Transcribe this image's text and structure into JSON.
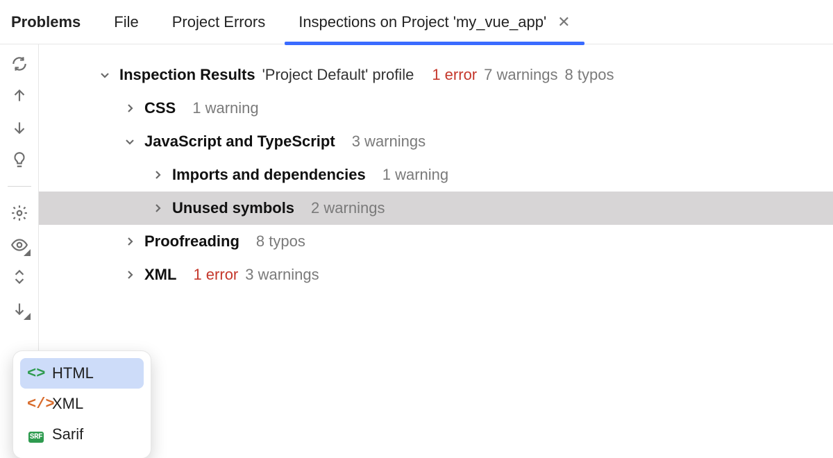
{
  "tabs": {
    "problems": "Problems",
    "file": "File",
    "project_errors": "Project Errors",
    "inspections": "Inspections on Project 'my_vue_app'"
  },
  "summary": {
    "title": "Inspection Results",
    "profile": "'Project Default' profile",
    "errors": "1 error",
    "warnings": "7 warnings",
    "typos": "8 typos"
  },
  "nodes": {
    "css": {
      "label": "CSS",
      "count": "1 warning"
    },
    "jsts": {
      "label": "JavaScript and TypeScript",
      "count": "3 warnings"
    },
    "imports": {
      "label": "Imports and dependencies",
      "count": "1 warning"
    },
    "unused": {
      "label": "Unused symbols",
      "count": "2 warnings"
    },
    "proof": {
      "label": "Proofreading",
      "count": "8 typos"
    },
    "xml": {
      "label": "XML",
      "errors": "1 error",
      "count": "3 warnings"
    }
  },
  "popup": {
    "html": "HTML",
    "xml": "XML",
    "sarif": "Sarif"
  }
}
